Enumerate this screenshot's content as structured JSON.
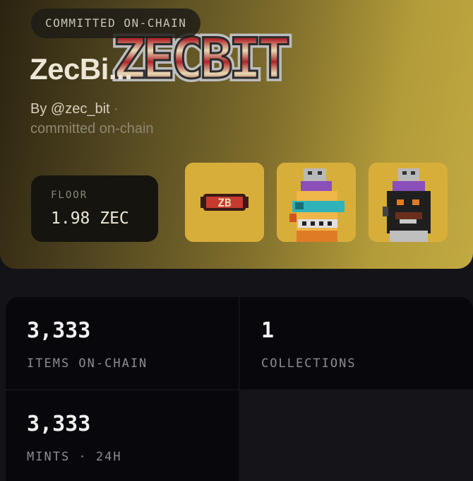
{
  "header": {
    "badge": "COMMITTED ON-CHAIN",
    "title": "ZecBi...",
    "logo_text": "ZECBIT",
    "byline_prefix": "By",
    "handle": "@zec_bit",
    "byline_suffix": "· committed on-chain"
  },
  "floor": {
    "label": "FLOOR",
    "value": "1.98 ZEC"
  },
  "thumbnails": [
    {
      "name": "zb-logo-token",
      "text": "ZB"
    },
    {
      "name": "nft-yellow-robot"
    },
    {
      "name": "nft-dark-robot"
    }
  ],
  "stats": [
    {
      "value": "3,333",
      "label": "ITEMS ON-CHAIN"
    },
    {
      "value": "1",
      "label": "COLLECTIONS"
    },
    {
      "value": "3,333",
      "label": "MINTS · 24H"
    }
  ],
  "colors": {
    "accent": "#c2a941",
    "thumb_bg": "#d8ae3a",
    "logo_red": "#b0242a"
  }
}
